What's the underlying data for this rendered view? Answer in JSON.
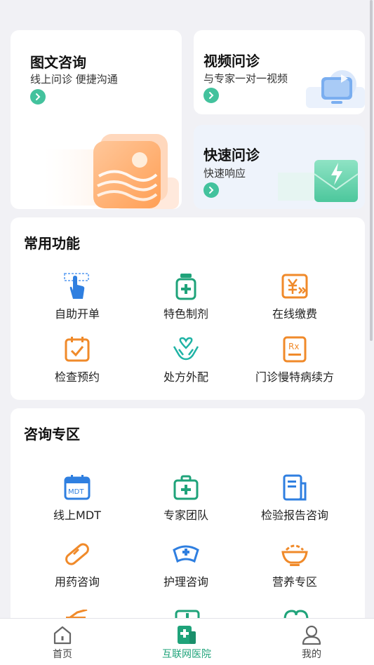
{
  "consult_cards": {
    "graphic": {
      "title": "图文咨询",
      "subtitle": "线上问诊 便捷沟通"
    },
    "video": {
      "title": "视频问诊",
      "subtitle": "与专家一对一视频"
    },
    "fast": {
      "title": "快速问诊",
      "subtitle": "快速响应"
    }
  },
  "common_functions": {
    "title": "常用功能",
    "items": [
      {
        "label": "自助开单",
        "icon": "hand-pointer-icon"
      },
      {
        "label": "特色制剂",
        "icon": "medicine-bottle-icon"
      },
      {
        "label": "在线缴费",
        "icon": "yuan-payment-icon"
      },
      {
        "label": "检查预约",
        "icon": "calendar-check-icon"
      },
      {
        "label": "处方外配",
        "icon": "hands-heart-icon"
      },
      {
        "label": "门诊慢特病续方",
        "icon": "prescription-icon"
      }
    ]
  },
  "consult_zone": {
    "title": "咨询专区",
    "items": [
      {
        "label": "线上MDT",
        "icon": "mdt-calendar-icon"
      },
      {
        "label": "专家团队",
        "icon": "medical-kit-icon"
      },
      {
        "label": "检验报告咨询",
        "icon": "report-document-icon"
      },
      {
        "label": "用药咨询",
        "icon": "pill-icon"
      },
      {
        "label": "护理咨询",
        "icon": "nurse-cap-icon"
      },
      {
        "label": "营养专区",
        "icon": "nutrition-bowl-icon"
      }
    ],
    "mdt_badge": "MDT"
  },
  "tabbar": {
    "items": [
      {
        "label": "首页",
        "icon": "home-icon",
        "active": false
      },
      {
        "label": "互联网医院",
        "icon": "hospital-plus-icon",
        "active": true
      },
      {
        "label": "我的",
        "icon": "user-icon",
        "active": false
      }
    ]
  },
  "colors": {
    "accent_green": "#1fa37a",
    "blue": "#2f7fe0",
    "orange": "#f08a2a"
  }
}
